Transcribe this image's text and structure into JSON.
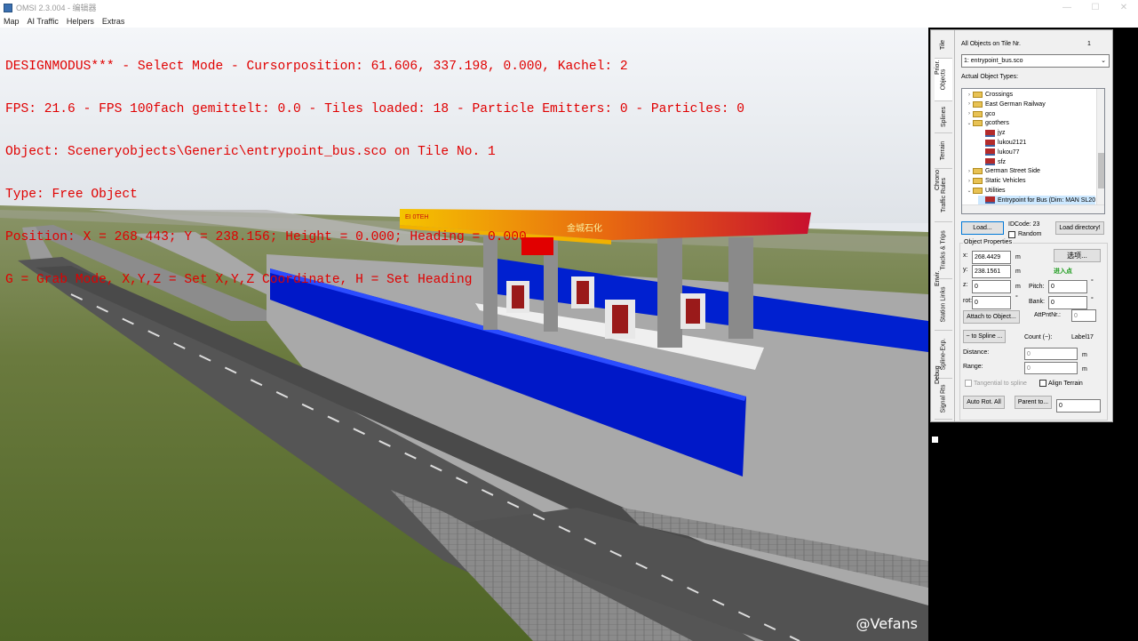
{
  "window": {
    "title": "OMSI 2.3.004 - 编辑器",
    "controls": [
      "—",
      "☐",
      "✕"
    ]
  },
  "menu": [
    "Map",
    "AI Traffic",
    "Helpers",
    "Extras"
  ],
  "overlay": {
    "lines": [
      "DESIGNMODUS*** - Select Mode - Cursorposition: 61.606, 337.198, 0.000, Kachel: 2",
      "FPS: 21.6 - FPS 100fach gemittelt: 0.0 - Tiles loaded: 18 - Particle Emitters: 0 - Particles: 0",
      "Object: Sceneryobjects\\Generic\\entrypoint_bus.sco on Tile No. 1",
      "Type: Free Object",
      "Position: X = 268.443; Y = 238.156; Height = 0.000; Heading = 0.000",
      "G = Grab Mode, X,Y,Z = Set X,Y,Z Coordinate, H = Set Heading"
    ],
    "color": "#e00000"
  },
  "scene": {
    "canopy_sign": "金城石化",
    "canopy_small": "EI 0TEH"
  },
  "watermark": "@Vefans",
  "panel": {
    "tabs": [
      "Tile",
      "Objects",
      "Prior.",
      "Splines",
      "Terrain",
      "Chrono",
      "Traffic Rules",
      "Tracks & Trips",
      "Envir.",
      "Station Links",
      "Spline-Exp.",
      "Debug",
      "Signal Rts"
    ],
    "all_objects_label": "All Objects on Tile Nr.",
    "tile_nr": "1",
    "object_select": "1: entrypoint_bus.sco",
    "actual_types_label": "Actual Object Types:",
    "tree": [
      {
        "label": "Crossings",
        "type": "folder",
        "level": 0,
        "expand": "›"
      },
      {
        "label": "East German Railway",
        "type": "folder",
        "level": 0,
        "expand": "›"
      },
      {
        "label": "gco",
        "type": "folder",
        "level": 0,
        "expand": "›"
      },
      {
        "label": "gcothers",
        "type": "folder",
        "level": 0,
        "expand": "⌄"
      },
      {
        "label": "jyz",
        "type": "object",
        "level": 1,
        "expand": ""
      },
      {
        "label": "lukou2121",
        "type": "object",
        "level": 1,
        "expand": ""
      },
      {
        "label": "lukou77",
        "type": "object",
        "level": 1,
        "expand": ""
      },
      {
        "label": "sfz",
        "type": "object",
        "level": 1,
        "expand": ""
      },
      {
        "label": "German Street Side",
        "type": "folder",
        "level": 0,
        "expand": "›"
      },
      {
        "label": "Static Vehicles",
        "type": "folder",
        "level": 0,
        "expand": "›"
      },
      {
        "label": "Utilities",
        "type": "folder",
        "level": 0,
        "expand": "⌄"
      },
      {
        "label": "Entrypoint for Bus (Dim: MAN SL20",
        "type": "object",
        "level": 1,
        "expand": ""
      }
    ],
    "load_button": "Load...",
    "idcode_label": "IDCode: 23",
    "random_label": "Random",
    "load_dir_button": "Load directory!",
    "props_title": "Object Properties",
    "x_label": "x:",
    "x_value": "268.4429",
    "y_label": "y:",
    "y_value": "238.1561",
    "z_label": "z:",
    "z_value": "0",
    "rot_label": "rot:",
    "rot_value": "0",
    "pitch_label": "Pitch:",
    "pitch_value": "0",
    "bank_label": "Bank:",
    "bank_value": "0",
    "unit_m": "m",
    "unit_deg": "°",
    "options_button": "选项...",
    "entry_label": "进入点",
    "entry_color": "#1a9a1a",
    "attach_button": "Attach to Object...",
    "attpnt_label": "AttPntNr.:",
    "attpnt_value": "0",
    "to_spline_button": "~ to Spline ...",
    "count_label": "Count (~):",
    "label_value": "Label17",
    "distance_label": "Distance:",
    "distance_value": "0",
    "range_label": "Range:",
    "range_value": "0",
    "tangential_label": "Tangential to spline",
    "align_label": "Align Terrain",
    "autorot_button": "Auto Rot. All",
    "parent_button": "Parent to...",
    "parent_value": "0"
  }
}
